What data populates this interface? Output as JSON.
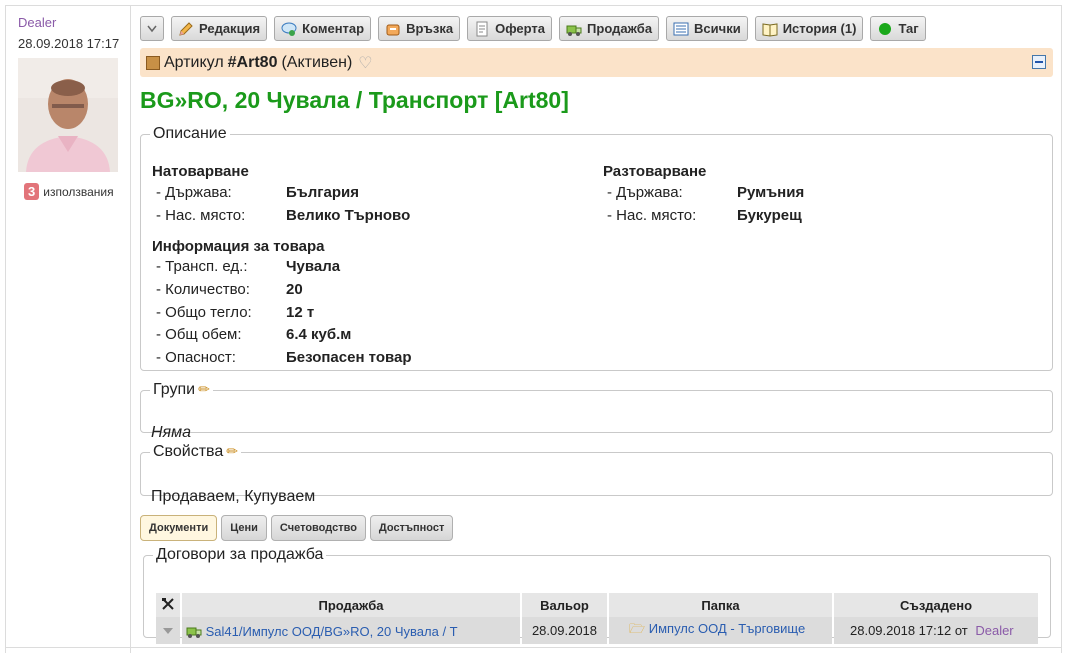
{
  "user": {
    "name": "Dealer",
    "date": "28.09.2018 17:17",
    "usage_count": "3",
    "usage_label": "използвания"
  },
  "toolbar": {
    "buttons": [
      {
        "label": "Редакция",
        "icon": "pencil-icon"
      },
      {
        "label": "Коментар",
        "icon": "comment-icon"
      },
      {
        "label": "Връзка",
        "icon": "link-icon"
      },
      {
        "label": "Оферта",
        "icon": "document-icon"
      },
      {
        "label": "Продажба",
        "icon": "truck-icon"
      },
      {
        "label": "Всички",
        "icon": "list-icon"
      },
      {
        "label": "История (1)",
        "icon": "book-icon"
      },
      {
        "label": "Таг",
        "icon": "green-dot-icon"
      }
    ]
  },
  "article": {
    "prefix": "Артикул",
    "code": "#Art80",
    "status": "(Активен)",
    "title": "BG»RO, 20 Чувала / Транспорт [Art80]"
  },
  "description": {
    "legend": "Описание",
    "loading": {
      "heading": "Натоварване",
      "rows": [
        {
          "label": "- Държава:",
          "value": "България"
        },
        {
          "label": "- Нас. място:",
          "value": "Велико Търново"
        }
      ]
    },
    "unloading": {
      "heading": "Разтоварване",
      "rows": [
        {
          "label": "- Държава:",
          "value": "Румъния"
        },
        {
          "label": "- Нас. място:",
          "value": "Букурещ"
        }
      ]
    },
    "cargo": {
      "heading": "Информация за товара",
      "rows": [
        {
          "label": "- Трансп. ед.:",
          "value": "Чувала"
        },
        {
          "label": "- Количество:",
          "value": "20"
        },
        {
          "label": "- Общо тегло:",
          "value": "12 т"
        },
        {
          "label": "- Общ обем:",
          "value": "6.4 куб.м"
        },
        {
          "label": "- Опасност:",
          "value": "Безопасен товар"
        }
      ]
    }
  },
  "groups": {
    "legend": "Групи",
    "value": "Няма"
  },
  "properties": {
    "legend": "Свойства",
    "value": "Продаваем, Купуваем"
  },
  "tabs": [
    "Документи",
    "Цени",
    "Счетоводство",
    "Достъпност"
  ],
  "contracts": {
    "legend": "Договори за продажба",
    "headers": [
      "Продажба",
      "Вальор",
      "Папка",
      "Създадено"
    ],
    "rows": [
      {
        "sale": "Sal41/Импулс ООД/BG»RO, 20 Чувала / Т",
        "date": "28.09.2018",
        "folder": "Импулс ООД - Търговище",
        "created": "28.09.2018 17:12 от",
        "created_by": "Dealer"
      }
    ]
  }
}
